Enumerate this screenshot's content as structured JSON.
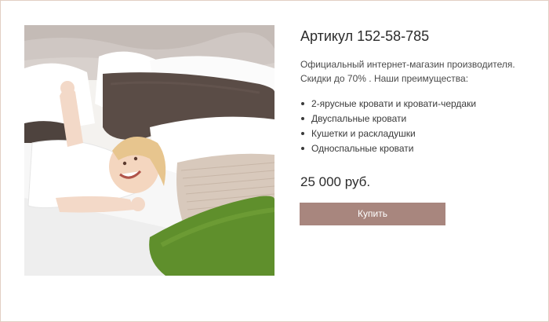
{
  "product": {
    "title": "Артикул 152-58-785",
    "description_line1": "Официальный интернет-магазин производителя.",
    "description_line2": "Скидки до 70% . Наши преимущества:",
    "benefits": [
      "2-ярусные кровати и кровати-чердаки",
      "Двуспальные кровати",
      "Кушетки и раскладушки",
      "Односпальные кровати"
    ],
    "price": "25 000 руб.",
    "buy_label": "Купить"
  },
  "colors": {
    "accent": "#a8867e",
    "frame_border": "#e2cfc4",
    "text": "#333333"
  }
}
